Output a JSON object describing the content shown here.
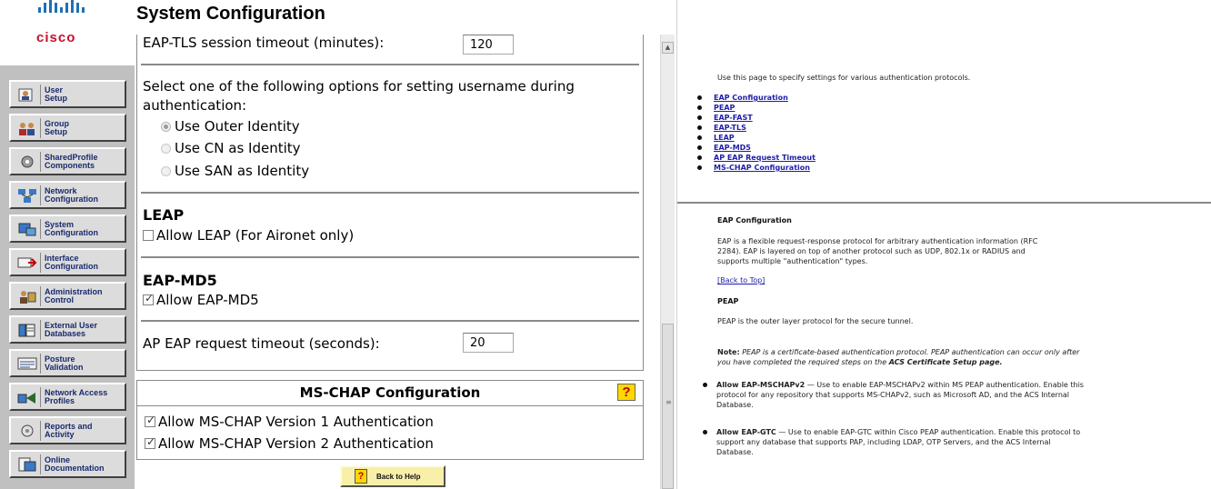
{
  "brand": {
    "logo_text": "cisco"
  },
  "page_title": "System Configuration",
  "nav": {
    "items": [
      {
        "line1": "User",
        "line2": "Setup",
        "icon": "user-setup-icon"
      },
      {
        "line1": "Group",
        "line2": "Setup",
        "icon": "group-setup-icon"
      },
      {
        "line1": "SharedProfile",
        "line2": "Components",
        "icon": "shared-profile-icon"
      },
      {
        "line1": "Network",
        "line2": "Configuration",
        "icon": "network-config-icon"
      },
      {
        "line1": "System",
        "line2": "Configuration",
        "icon": "system-config-icon"
      },
      {
        "line1": "Interface",
        "line2": "Configuration",
        "icon": "interface-config-icon"
      },
      {
        "line1": "Administration",
        "line2": "Control",
        "icon": "administration-icon"
      },
      {
        "line1": "External User",
        "line2": "Databases",
        "icon": "external-db-icon"
      },
      {
        "line1": "Posture",
        "line2": "Validation",
        "icon": "posture-icon"
      },
      {
        "line1": "Network Access",
        "line2": "Profiles",
        "icon": "network-access-icon"
      },
      {
        "line1": "Reports and",
        "line2": "Activity",
        "icon": "reports-icon"
      },
      {
        "line1": "Online",
        "line2": "Documentation",
        "icon": "documentation-icon"
      }
    ]
  },
  "config": {
    "eap_tls_timeout_label": "EAP-TLS session timeout (minutes):",
    "eap_tls_timeout_value": "120",
    "username_option_prompt_line1": "Select one of the following options for setting username during",
    "username_option_prompt_line2": "authentication:",
    "identity_options": [
      {
        "label": "Use Outer Identity",
        "selected": true
      },
      {
        "label": "Use CN as Identity",
        "selected": false
      },
      {
        "label": "Use SAN as Identity",
        "selected": false
      }
    ],
    "leap_heading": "LEAP",
    "leap_checkbox_label": "Allow LEAP (For Aironet only)",
    "leap_checked": false,
    "eap_md5_heading": "EAP-MD5",
    "eap_md5_checkbox_label": "Allow EAP-MD5",
    "eap_md5_checked": true,
    "ap_eap_timeout_label": "AP EAP request timeout (seconds):",
    "ap_eap_timeout_value": "20"
  },
  "mschap": {
    "title": "MS-CHAP Configuration",
    "help_glyph": "?",
    "v1_label": "Allow MS-CHAP Version 1 Authentication",
    "v1_checked": true,
    "v2_label": "Allow MS-CHAP Version 2 Authentication",
    "v2_checked": true
  },
  "back_to_help": {
    "label": "Back to Help",
    "glyph": "?"
  },
  "help": {
    "intro": "Use this page to specify settings for various authentication protocols.",
    "toc": [
      "EAP Configuration",
      "PEAP",
      "EAP-FAST",
      "EAP-TLS",
      "LEAP",
      "EAP-MD5",
      "AP EAP Request Timeout",
      "MS-CHAP Configuration"
    ],
    "eap_config_heading": "EAP Configuration",
    "eap_config_body": [
      "EAP is a flexible request-response protocol for arbitrary authentication information (RFC",
      "2284). EAP is layered on top of another protocol such as UDP, 802.1x or RADIUS and",
      "supports multiple \"authentication\" types."
    ],
    "back_to_top": "[Back to Top]",
    "peap_heading": "PEAP",
    "peap_body": "PEAP is the outer layer protocol for the secure tunnel.",
    "note_label": "Note:",
    "note_line1": "PEAP is a certificate-based authentication protocol. PEAP authentication can occur only after",
    "note_line2_prefix": "you have completed the required steps on the ",
    "note_line2_emph": "ACS Certificate Setup page.",
    "bullets": [
      {
        "term": "Allow EAP-MSCHAPv2",
        "text_line1": " — Use to enable EAP-MSCHAPv2 within MS PEAP authentication. Enable this",
        "text_line2": "protocol for any repository that supports MS-CHAPv2, such as Microsoft AD, and the ACS Internal",
        "text_line3": "Database."
      },
      {
        "term": "Allow EAP-GTC",
        "text_line1": " — Use to enable EAP-GTC within Cisco PEAP authentication. Enable this protocol to",
        "text_line2": "support any database that supports PAP, including LDAP, OTP Servers, and the ACS Internal",
        "text_line3": "Database."
      }
    ]
  }
}
